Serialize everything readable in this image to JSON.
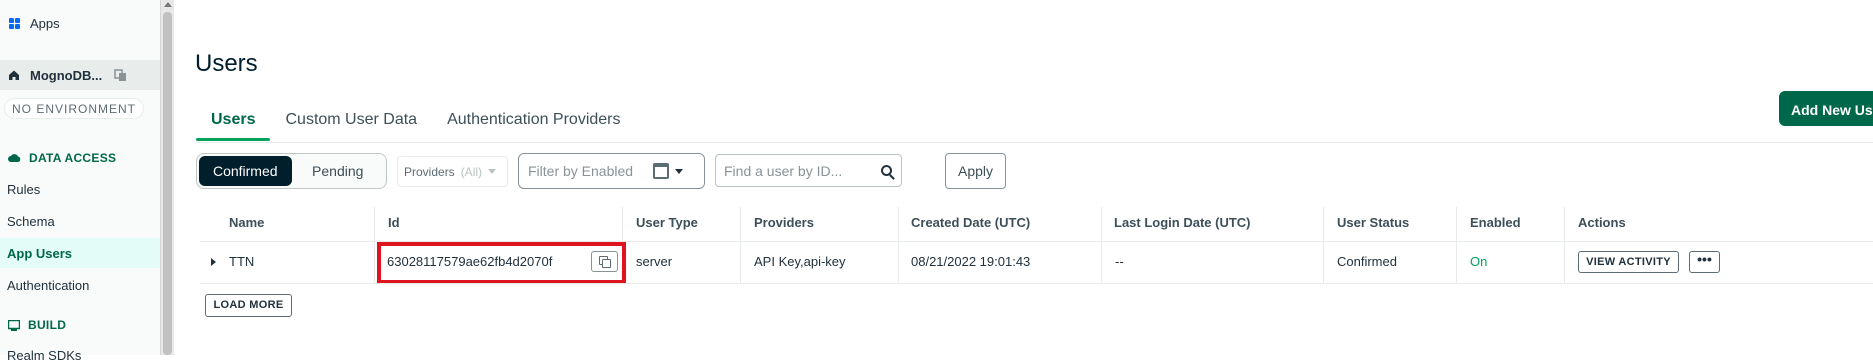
{
  "sidebar": {
    "apps_label": "Apps",
    "app_name": "MognoDB...",
    "environment": "NO ENVIRONMENT",
    "data_access_label": "DATA ACCESS",
    "items": [
      "Rules",
      "Schema",
      "App Users",
      "Authentication"
    ],
    "build_label": "BUILD",
    "partial_item": "Realm SDKs"
  },
  "page": {
    "title": "Users",
    "tabs": [
      "Users",
      "Custom User Data",
      "Authentication Providers"
    ],
    "add_button": "Add New User"
  },
  "filters": {
    "segment": [
      "Confirmed",
      "Pending"
    ],
    "providers_label": "Providers",
    "providers_value": "(All)",
    "enabled_placeholder": "Filter by Enabled",
    "find_placeholder": "Find a user by ID...",
    "apply": "Apply"
  },
  "table": {
    "columns": [
      "Name",
      "Id",
      "User Type",
      "Providers",
      "Created Date (UTC)",
      "Last Login Date (UTC)",
      "User Status",
      "Enabled",
      "Actions"
    ],
    "rows": [
      {
        "name": "TTN",
        "id": "63028117579ae62fb4d2070f",
        "user_type": "server",
        "providers": "API Key,api-key",
        "created": "08/21/2022 19:01:43",
        "last_login": "--",
        "status": "Confirmed",
        "enabled": "On",
        "view_activity": "VIEW ACTIVITY",
        "more": "•••"
      }
    ],
    "load_more": "LOAD MORE"
  },
  "colors": {
    "primary": "#00684a",
    "accent_green": "#00a35c",
    "highlight_red": "#e0141e",
    "dark": "#001e2b"
  }
}
